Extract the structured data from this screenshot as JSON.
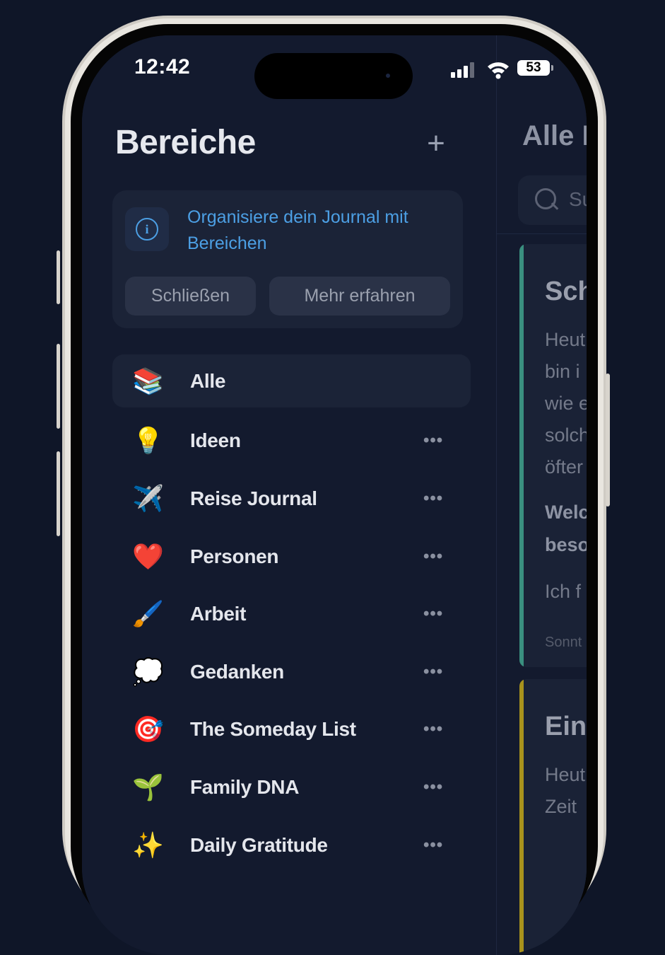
{
  "status_bar": {
    "time": "12:42",
    "battery": "53"
  },
  "sidebar": {
    "title": "Bereiche",
    "add_icon": "plus-icon",
    "info_card": {
      "icon": "info-icon",
      "text": "Organisiere dein Journal mit Bereichen",
      "close_label": "Schließen",
      "more_label": "Mehr erfahren"
    },
    "items": [
      {
        "emoji": "📚",
        "label": "Alle",
        "selected": true
      },
      {
        "emoji": "💡",
        "label": "Ideen"
      },
      {
        "emoji": "✈️",
        "label": "Reise Journal"
      },
      {
        "emoji": "❤️",
        "label": "Personen"
      },
      {
        "emoji": "🖌️",
        "label": "Arbeit"
      },
      {
        "emoji": "💭",
        "label": "Gedanken"
      },
      {
        "emoji": "🎯",
        "label": "The Someday List"
      },
      {
        "emoji": "🌱",
        "label": "Family DNA"
      },
      {
        "emoji": "✨",
        "label": "Daily Gratitude"
      }
    ],
    "more_dots": "•••"
  },
  "main": {
    "title": "Alle Einträge",
    "search_placeholder": "Suchen",
    "entries": [
      {
        "accent": "#3a8f7f",
        "title": "Sch",
        "body_lines": [
          "Heut",
          "bin i",
          "wie e",
          "solch",
          "öfter"
        ],
        "question_lines": [
          "Welc",
          "beso"
        ],
        "answer": "Ich f",
        "date": "Sonnt"
      },
      {
        "accent": "#a8921c",
        "title": "Ein",
        "body_lines": [
          "Heut",
          "Zeit"
        ]
      }
    ]
  }
}
